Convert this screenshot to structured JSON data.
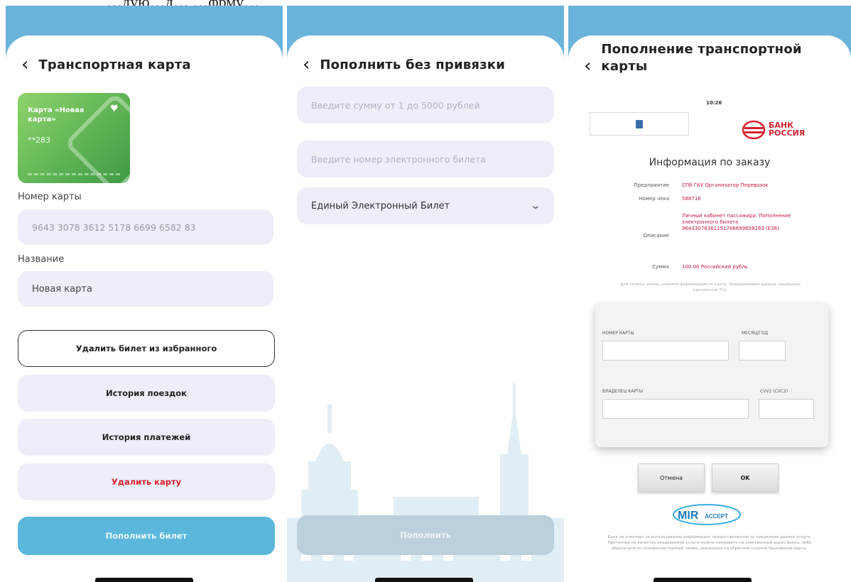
{
  "top_text": "…дую…д…    …фрму…",
  "panel1": {
    "title": "Транспортная карта",
    "card": {
      "name": "Карта «Новая карта»",
      "number": "**283"
    },
    "card_number_label": "Номер карты",
    "card_number_value": "9643 3078 3612 5178 6699 6582 83",
    "name_label": "Название",
    "name_value": "Новая карта",
    "buttons": {
      "remove_favorite": "Удалить билет из избранного",
      "trip_history": "История поездок",
      "payment_history": "История платежей",
      "delete_card": "Удалить карту",
      "top_up": "Пополнить билет"
    }
  },
  "panel2": {
    "title": "Пополнить без привязки",
    "amount_placeholder": "Введите сумму от 1 до 5000 рублей",
    "ticket_placeholder": "Введите номер электронного билета",
    "ticket_type": "Единый Электронный Билет",
    "submit": "Пополнить"
  },
  "panel3": {
    "title": "Пополнение транспортной карты",
    "time": "10:26",
    "bank_line1": "БАНК",
    "bank_line2": "РОССИЯ",
    "order_title": "Информация по заказу",
    "order": {
      "enterprise_label": "Предприятие",
      "enterprise_value": "СПб ГКУ Организатор Перевозок",
      "check_label": "Номер чека",
      "check_value": "588716",
      "description_label": "Описание",
      "description_value": "Личный кабинет пассажира: Пополнение электронного билета 96433078361251786699658283 (Е36)",
      "sum_label": "Сумма",
      "sum_value": "100.00 Российский рубль"
    },
    "note": "Для оплаты заказа укажите информацию по карте. Передаваемые данные защищены протоколом TLS.",
    "form": {
      "card_number": "НОМЕР КАРТЫ",
      "exp": "МЕСЯЦ/ГОД",
      "holder": "ВЛАДЕЛЕЦ КАРТЫ",
      "cvv": "CVV2 (CVC2)"
    },
    "cancel": "Отмена",
    "ok": "OK",
    "mir_logo": "MIR ACCEPT",
    "disclaimer": "Банк не отвечает за использование информации, предоставленной за пределами данной услуги. Претензии по качеству оказываемой услуги можно направить на электронный адрес банка, либо обратиться по телефонам горячей линии, указанным на обратной стороне банковской карты."
  }
}
